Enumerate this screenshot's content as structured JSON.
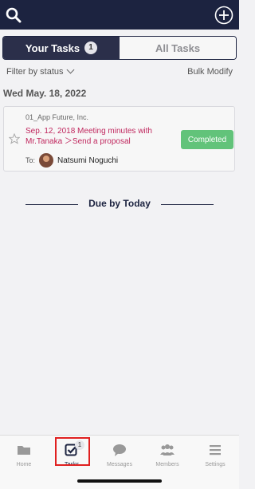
{
  "header": {
    "search_icon": "search-icon",
    "add_icon": "plus-circle-icon"
  },
  "tabs": {
    "your_tasks": "Your Tasks",
    "your_tasks_count": "1",
    "all_tasks": "All Tasks"
  },
  "filter": {
    "status_label": "Filter by status",
    "bulk_modify": "Bulk Modify"
  },
  "date_header": "Wed May. 18, 2022",
  "task": {
    "company": "01_App Future, Inc.",
    "title": "Sep. 12, 2018 Meeting minutes with Mr.Tanaka ＞Send a proposal",
    "to_label": "To:",
    "assignee": "Natsumi Noguchi",
    "status": "Completed",
    "status_color": "#62c37a"
  },
  "section": {
    "label": "Due by Today"
  },
  "bottom_nav": {
    "home": "Home",
    "tasks": "Tasks",
    "tasks_badge": "1",
    "messages": "Messages",
    "members": "Members",
    "settings": "Settings"
  },
  "colors": {
    "header_bg": "#1c2340",
    "title_color": "#c0275e",
    "highlight": "#e02020"
  }
}
